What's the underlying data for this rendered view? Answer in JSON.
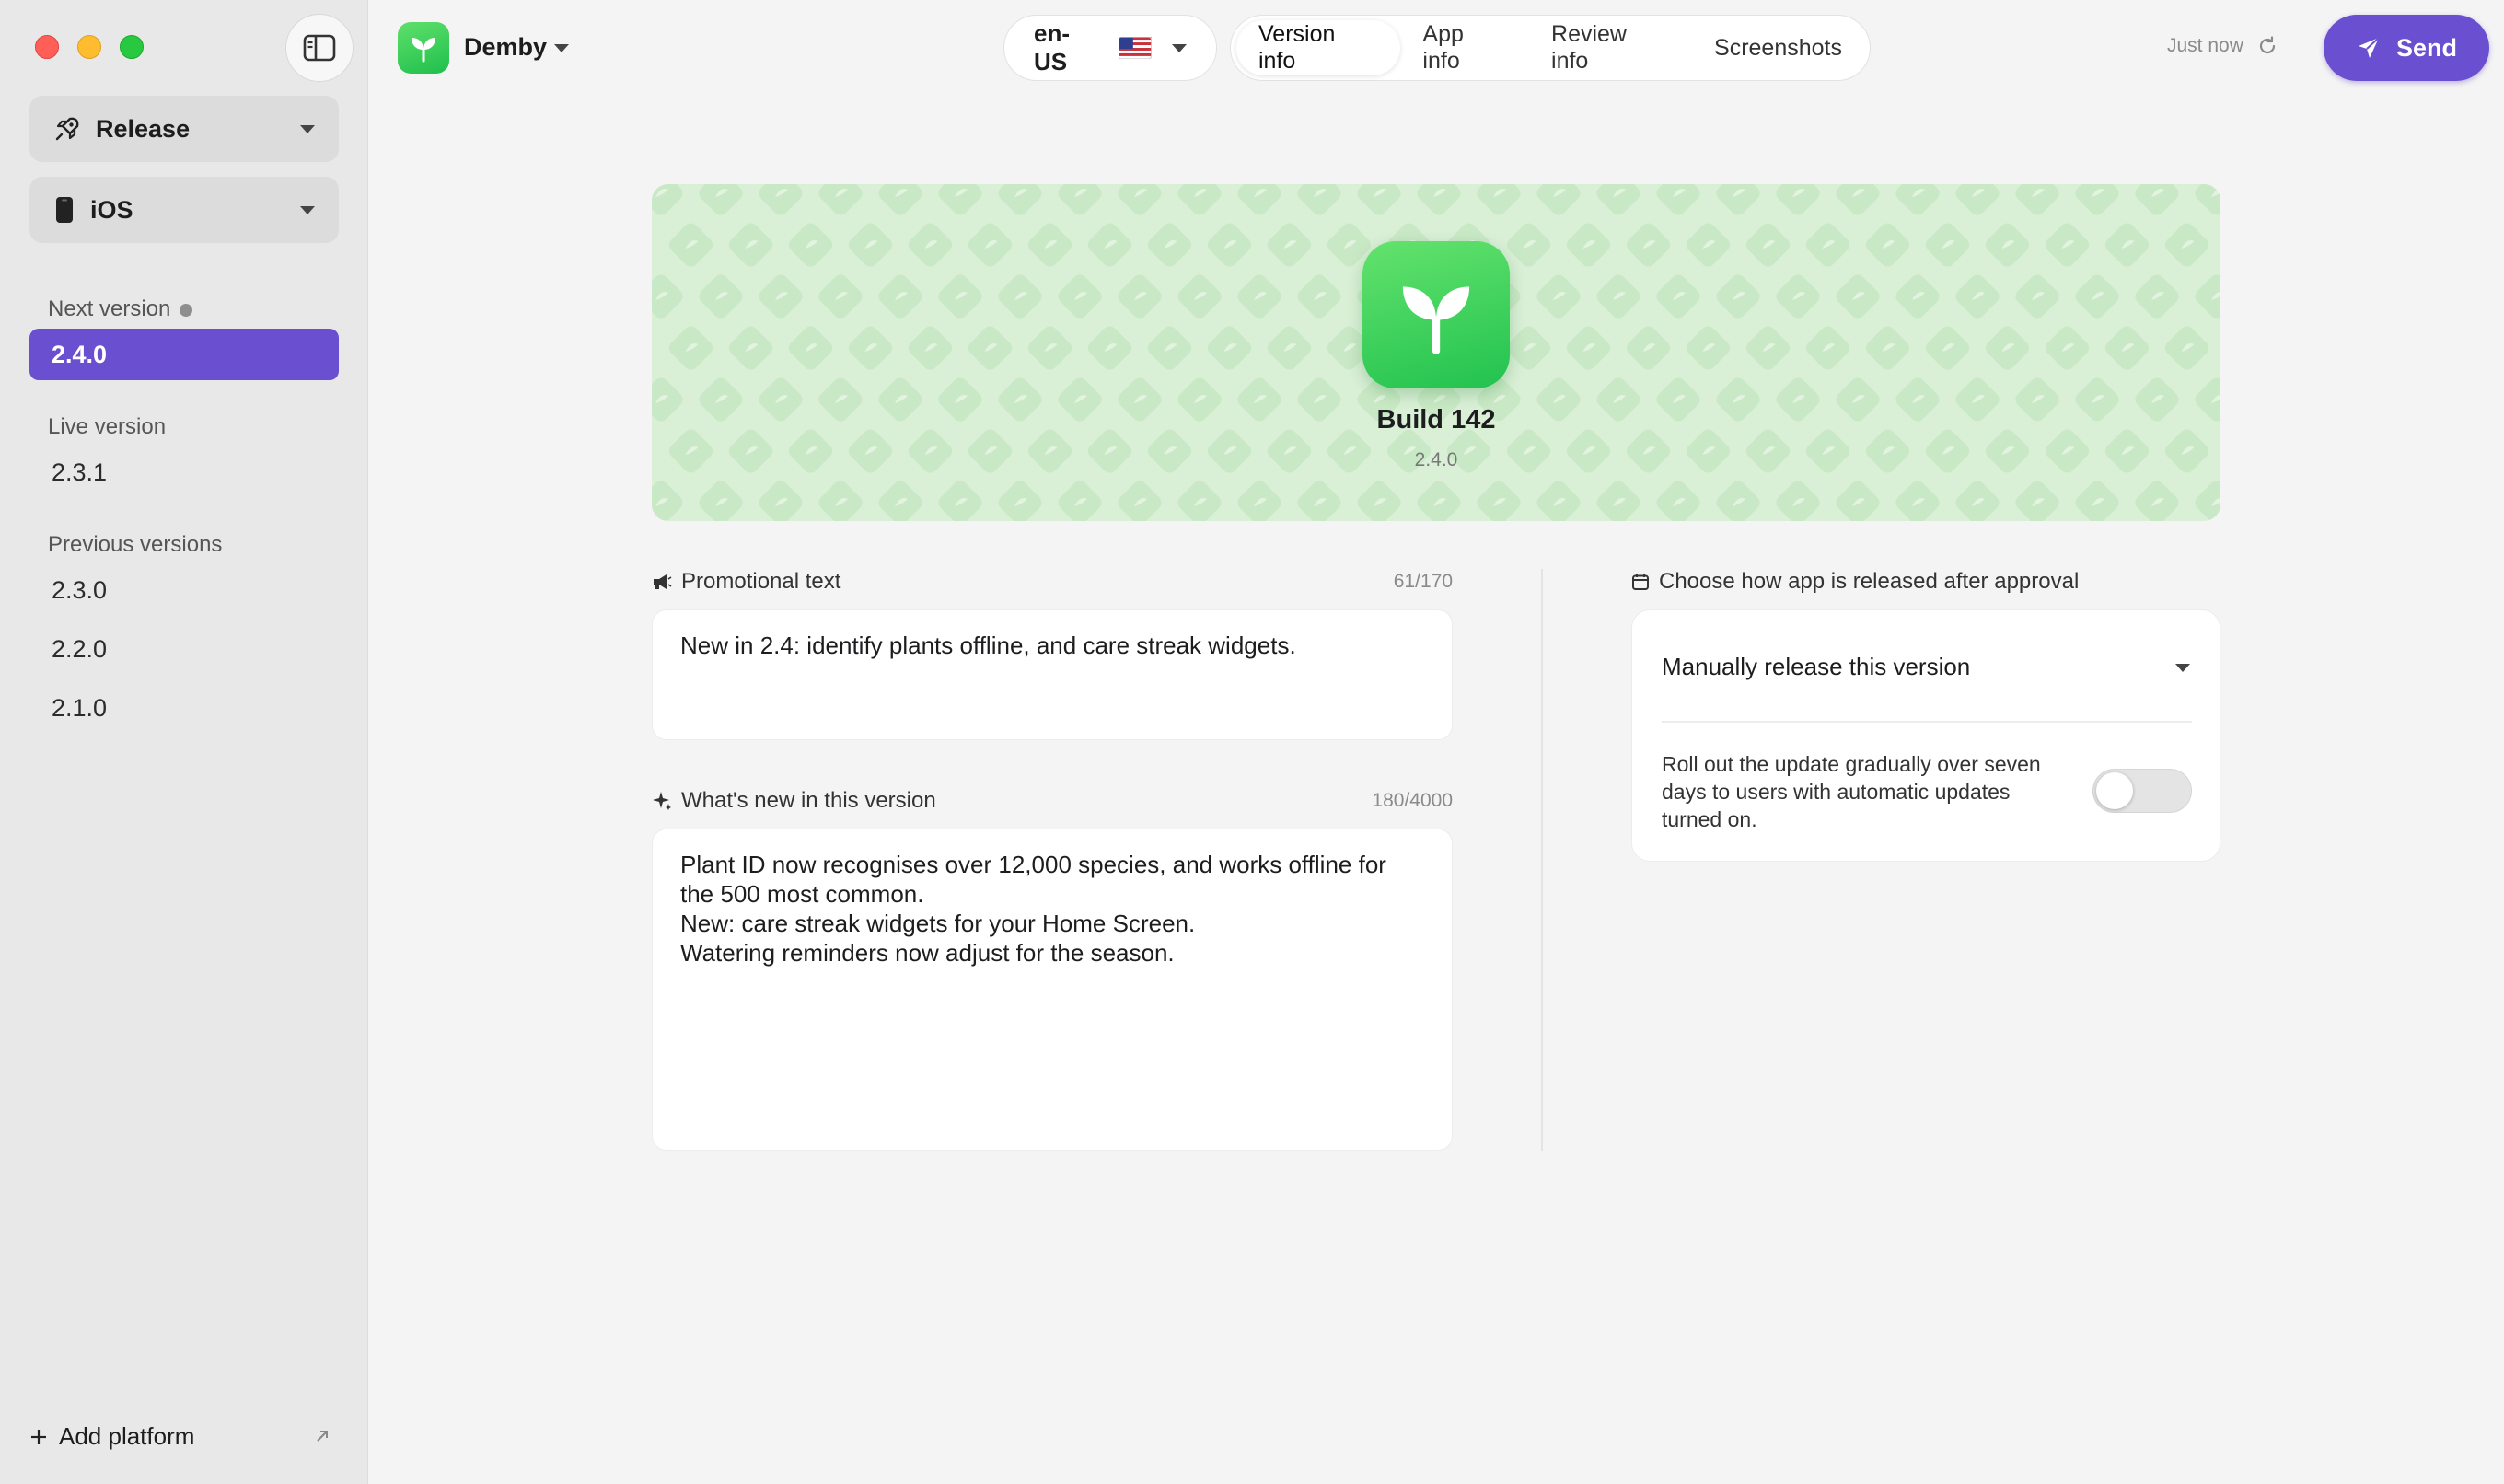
{
  "app": {
    "name": "Demby"
  },
  "sidebar": {
    "release_selector": {
      "label": "Release"
    },
    "platform_selector": {
      "label": "iOS"
    },
    "next_version": {
      "heading": "Next version",
      "items": [
        "2.4.0"
      ]
    },
    "live_version": {
      "heading": "Live version",
      "items": [
        "2.3.1"
      ]
    },
    "previous_versions": {
      "heading": "Previous versions",
      "items": [
        "2.3.0",
        "2.2.0",
        "2.1.0"
      ]
    },
    "add_platform_label": "Add platform"
  },
  "toolbar": {
    "locale": "en-US",
    "tabs": [
      "Version info",
      "App info",
      "Review info",
      "Screenshots"
    ],
    "active_tab": "Version info",
    "sync_status": "Just now",
    "send_label": "Send"
  },
  "hero": {
    "build_title": "Build 142",
    "build_version": "2.4.0"
  },
  "promotional": {
    "label": "Promotional text",
    "counter": "61/170",
    "value": "New in 2.4: identify plants offline, and care streak widgets."
  },
  "whats_new": {
    "label": "What's new in this version",
    "counter": "180/4000",
    "lines": [
      "Plant ID now recognises over 12,000 species, and works offline for",
      "the 500 most common.",
      "New: care streak widgets for your Home Screen.",
      "Watering reminders now adjust for the season."
    ]
  },
  "release": {
    "label": "Choose how app is released after approval",
    "selected_option": "Manually release this version",
    "rollout_text": "Roll out the update gradually over seven days to users with automatic updates turned on.",
    "rollout_enabled": false
  },
  "colors": {
    "accent": "#6a4fd0",
    "brand_green": "#28c44f",
    "hero_bg": "#d9efd6"
  },
  "icons": [
    "sidebar-toggle-icon",
    "rocket-icon",
    "phone-icon",
    "plus-icon",
    "external-link-icon",
    "sprout-icon",
    "chevron-down-icon",
    "us-flag-icon",
    "refresh-icon",
    "paper-plane-icon",
    "megaphone-icon",
    "sparkle-icon",
    "calendar-icon"
  ]
}
